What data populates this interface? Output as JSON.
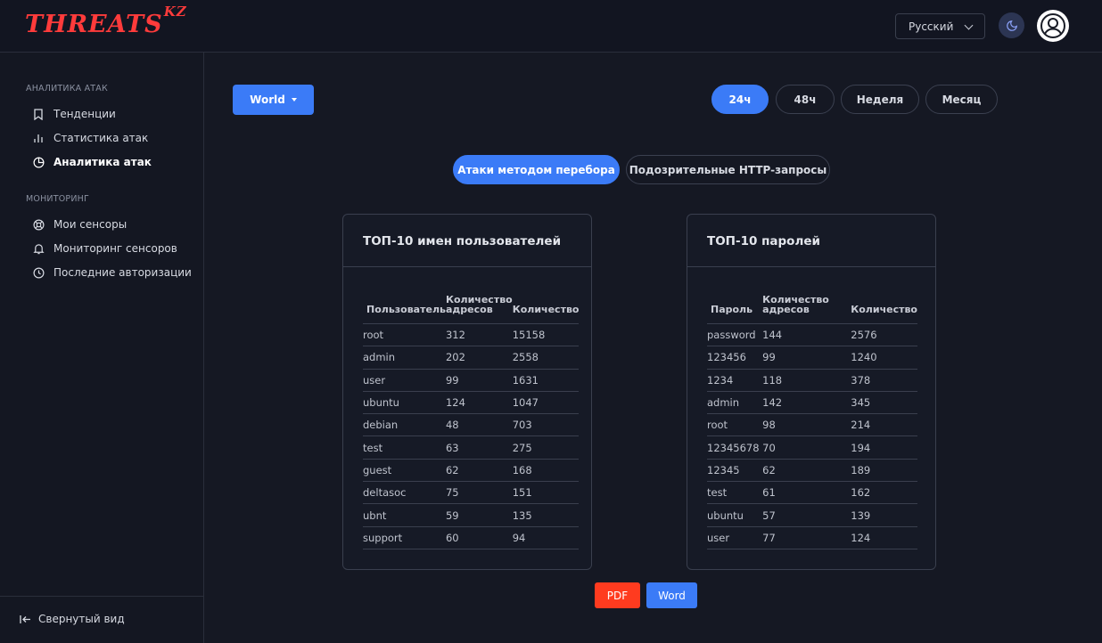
{
  "app": {
    "logo_main": "THREATS",
    "logo_suffix": "KZ"
  },
  "header": {
    "language": "Русский"
  },
  "sidebar": {
    "section1": "Аналитика атак",
    "section2": "Мониторинг",
    "items": [
      {
        "label": "Тенденции",
        "icon": "bookmark-icon"
      },
      {
        "label": "Статистика атак",
        "icon": "bar-chart-icon"
      },
      {
        "label": "Аналитика атак",
        "icon": "pie-chart-icon",
        "active": true
      },
      {
        "label": "Мои сенсоры",
        "icon": "lifebuoy-icon"
      },
      {
        "label": "Мониторинг сенсоров",
        "icon": "bell-icon"
      },
      {
        "label": "Последние авторизации",
        "icon": "clock-icon"
      }
    ],
    "collapse_label": "Свернутый вид"
  },
  "main": {
    "region": "World",
    "periods": [
      "24ч",
      "48ч",
      "Неделя",
      "Месяц"
    ],
    "active_period": "24ч",
    "tabs": [
      "Атаки методом перебора",
      "Подозрительные HTTP-запросы"
    ],
    "active_tab": "Атаки методом перебора",
    "users_card": {
      "title": "ТОП-10 имен пользователей",
      "headers": [
        "Пользователь",
        "Количество адресов",
        "Количество"
      ],
      "rows": [
        [
          "root",
          "312",
          "15158"
        ],
        [
          "admin",
          "202",
          "2558"
        ],
        [
          "user",
          "99",
          "1631"
        ],
        [
          "ubuntu",
          "124",
          "1047"
        ],
        [
          "debian",
          "48",
          "703"
        ],
        [
          "test",
          "63",
          "275"
        ],
        [
          "guest",
          "62",
          "168"
        ],
        [
          "deltasoc",
          "75",
          "151"
        ],
        [
          "ubnt",
          "59",
          "135"
        ],
        [
          "support",
          "60",
          "94"
        ]
      ]
    },
    "passwords_card": {
      "title": "ТОП-10 паролей",
      "headers": [
        "Пароль",
        "Количество адресов",
        "Количество"
      ],
      "rows": [
        [
          "password",
          "144",
          "2576"
        ],
        [
          "123456",
          "99",
          "1240"
        ],
        [
          "1234",
          "118",
          "378"
        ],
        [
          "admin",
          "142",
          "345"
        ],
        [
          "root",
          "98",
          "214"
        ],
        [
          "12345678",
          "70",
          "194"
        ],
        [
          "12345",
          "62",
          "189"
        ],
        [
          "test",
          "61",
          "162"
        ],
        [
          "ubuntu",
          "57",
          "139"
        ],
        [
          "user",
          "77",
          "124"
        ]
      ]
    },
    "export": {
      "pdf": "PDF",
      "word": "Word"
    }
  },
  "colors": {
    "accent": "#3b7bf7",
    "logo": "#ff3b3b",
    "pdf": "#ff3b1f",
    "word": "#3b7bf7"
  }
}
